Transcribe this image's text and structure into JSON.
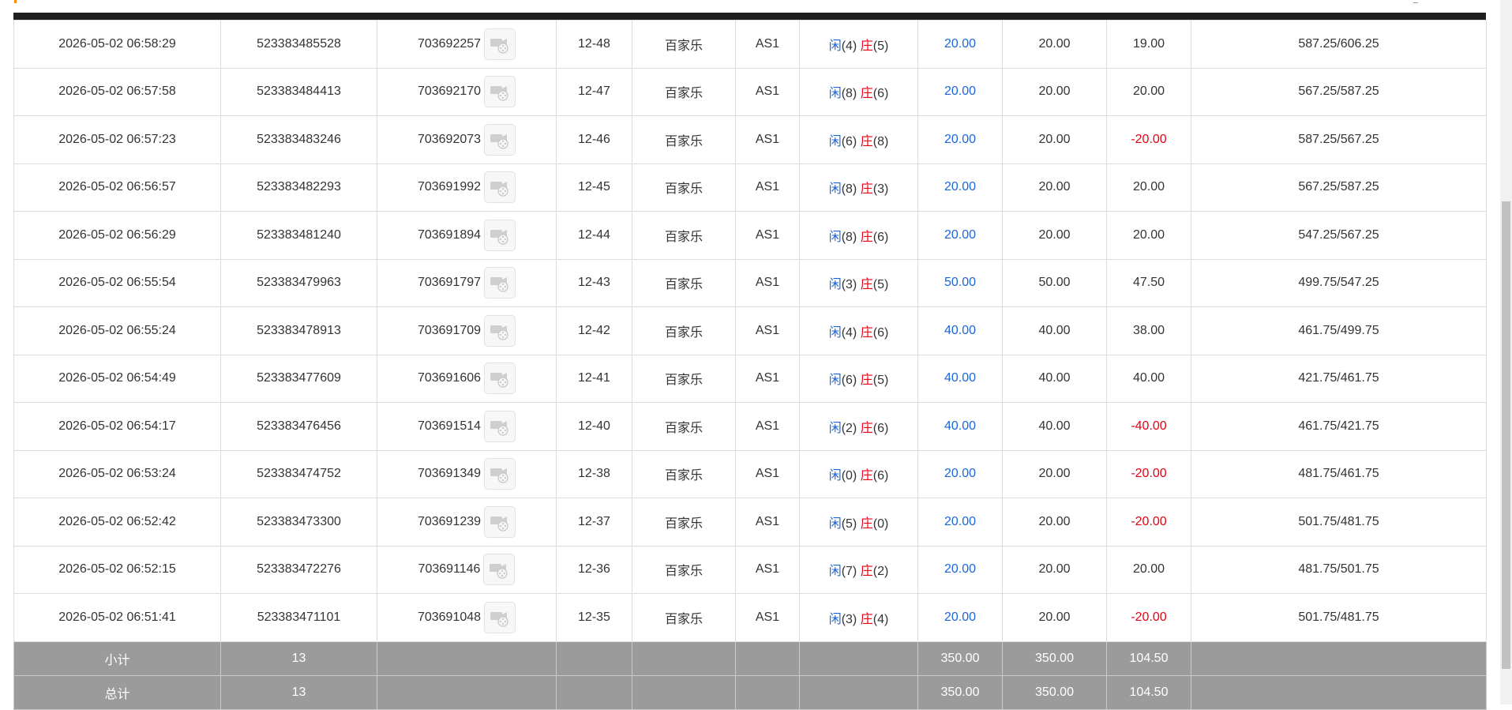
{
  "colors": {
    "header_bar": "#1f1f1f",
    "positive_blue": "#1a66d9",
    "negative_red": "#e60012",
    "summary_bg": "#9b9b9b"
  },
  "icons": {
    "video": "video-camera-reel-icon"
  },
  "rows": [
    {
      "time": "2026-05-02 06:58:29",
      "order_id": "523383485528",
      "round_id": "703692257",
      "shoe": "12-48",
      "game": "百家乐",
      "table": "AS1",
      "player_label": "闲",
      "player_score": "(4)",
      "banker_label": "庄",
      "banker_score": "(5)",
      "bet": "20.00",
      "valid_bet": "20.00",
      "win_loss": "19.00",
      "win_neg": false,
      "balance": "587.25/606.25"
    },
    {
      "time": "2026-05-02 06:57:58",
      "order_id": "523383484413",
      "round_id": "703692170",
      "shoe": "12-47",
      "game": "百家乐",
      "table": "AS1",
      "player_label": "闲",
      "player_score": "(8)",
      "banker_label": "庄",
      "banker_score": "(6)",
      "bet": "20.00",
      "valid_bet": "20.00",
      "win_loss": "20.00",
      "win_neg": false,
      "balance": "567.25/587.25"
    },
    {
      "time": "2026-05-02 06:57:23",
      "order_id": "523383483246",
      "round_id": "703692073",
      "shoe": "12-46",
      "game": "百家乐",
      "table": "AS1",
      "player_label": "闲",
      "player_score": "(6)",
      "banker_label": "庄",
      "banker_score": "(8)",
      "bet": "20.00",
      "valid_bet": "20.00",
      "win_loss": "-20.00",
      "win_neg": true,
      "balance": "587.25/567.25"
    },
    {
      "time": "2026-05-02 06:56:57",
      "order_id": "523383482293",
      "round_id": "703691992",
      "shoe": "12-45",
      "game": "百家乐",
      "table": "AS1",
      "player_label": "闲",
      "player_score": "(8)",
      "banker_label": "庄",
      "banker_score": "(3)",
      "bet": "20.00",
      "valid_bet": "20.00",
      "win_loss": "20.00",
      "win_neg": false,
      "balance": "567.25/587.25"
    },
    {
      "time": "2026-05-02 06:56:29",
      "order_id": "523383481240",
      "round_id": "703691894",
      "shoe": "12-44",
      "game": "百家乐",
      "table": "AS1",
      "player_label": "闲",
      "player_score": "(8)",
      "banker_label": "庄",
      "banker_score": "(6)",
      "bet": "20.00",
      "valid_bet": "20.00",
      "win_loss": "20.00",
      "win_neg": false,
      "balance": "547.25/567.25"
    },
    {
      "time": "2026-05-02 06:55:54",
      "order_id": "523383479963",
      "round_id": "703691797",
      "shoe": "12-43",
      "game": "百家乐",
      "table": "AS1",
      "player_label": "闲",
      "player_score": "(3)",
      "banker_label": "庄",
      "banker_score": "(5)",
      "bet": "50.00",
      "valid_bet": "50.00",
      "win_loss": "47.50",
      "win_neg": false,
      "balance": "499.75/547.25"
    },
    {
      "time": "2026-05-02 06:55:24",
      "order_id": "523383478913",
      "round_id": "703691709",
      "shoe": "12-42",
      "game": "百家乐",
      "table": "AS1",
      "player_label": "闲",
      "player_score": "(4)",
      "banker_label": "庄",
      "banker_score": "(6)",
      "bet": "40.00",
      "valid_bet": "40.00",
      "win_loss": "38.00",
      "win_neg": false,
      "balance": "461.75/499.75"
    },
    {
      "time": "2026-05-02 06:54:49",
      "order_id": "523383477609",
      "round_id": "703691606",
      "shoe": "12-41",
      "game": "百家乐",
      "table": "AS1",
      "player_label": "闲",
      "player_score": "(6)",
      "banker_label": "庄",
      "banker_score": "(5)",
      "bet": "40.00",
      "valid_bet": "40.00",
      "win_loss": "40.00",
      "win_neg": false,
      "balance": "421.75/461.75"
    },
    {
      "time": "2026-05-02 06:54:17",
      "order_id": "523383476456",
      "round_id": "703691514",
      "shoe": "12-40",
      "game": "百家乐",
      "table": "AS1",
      "player_label": "闲",
      "player_score": "(2)",
      "banker_label": "庄",
      "banker_score": "(6)",
      "bet": "40.00",
      "valid_bet": "40.00",
      "win_loss": "-40.00",
      "win_neg": true,
      "balance": "461.75/421.75"
    },
    {
      "time": "2026-05-02 06:53:24",
      "order_id": "523383474752",
      "round_id": "703691349",
      "shoe": "12-38",
      "game": "百家乐",
      "table": "AS1",
      "player_label": "闲",
      "player_score": "(0)",
      "banker_label": "庄",
      "banker_score": "(6)",
      "bet": "20.00",
      "valid_bet": "20.00",
      "win_loss": "-20.00",
      "win_neg": true,
      "balance": "481.75/461.75"
    },
    {
      "time": "2026-05-02 06:52:42",
      "order_id": "523383473300",
      "round_id": "703691239",
      "shoe": "12-37",
      "game": "百家乐",
      "table": "AS1",
      "player_label": "闲",
      "player_score": "(5)",
      "banker_label": "庄",
      "banker_score": "(0)",
      "bet": "20.00",
      "valid_bet": "20.00",
      "win_loss": "-20.00",
      "win_neg": true,
      "balance": "501.75/481.75"
    },
    {
      "time": "2026-05-02 06:52:15",
      "order_id": "523383472276",
      "round_id": "703691146",
      "shoe": "12-36",
      "game": "百家乐",
      "table": "AS1",
      "player_label": "闲",
      "player_score": "(7)",
      "banker_label": "庄",
      "banker_score": "(2)",
      "bet": "20.00",
      "valid_bet": "20.00",
      "win_loss": "20.00",
      "win_neg": false,
      "balance": "481.75/501.75"
    },
    {
      "time": "2026-05-02 06:51:41",
      "order_id": "523383471101",
      "round_id": "703691048",
      "shoe": "12-35",
      "game": "百家乐",
      "table": "AS1",
      "player_label": "闲",
      "player_score": "(3)",
      "banker_label": "庄",
      "banker_score": "(4)",
      "bet": "20.00",
      "valid_bet": "20.00",
      "win_loss": "-20.00",
      "win_neg": true,
      "balance": "501.75/481.75"
    }
  ],
  "subtotal": {
    "label": "小计",
    "count": "13",
    "bet": "350.00",
    "valid_bet": "350.00",
    "win_loss": "104.50"
  },
  "total": {
    "label": "总计",
    "count": "13",
    "bet": "350.00",
    "valid_bet": "350.00",
    "win_loss": "104.50"
  }
}
